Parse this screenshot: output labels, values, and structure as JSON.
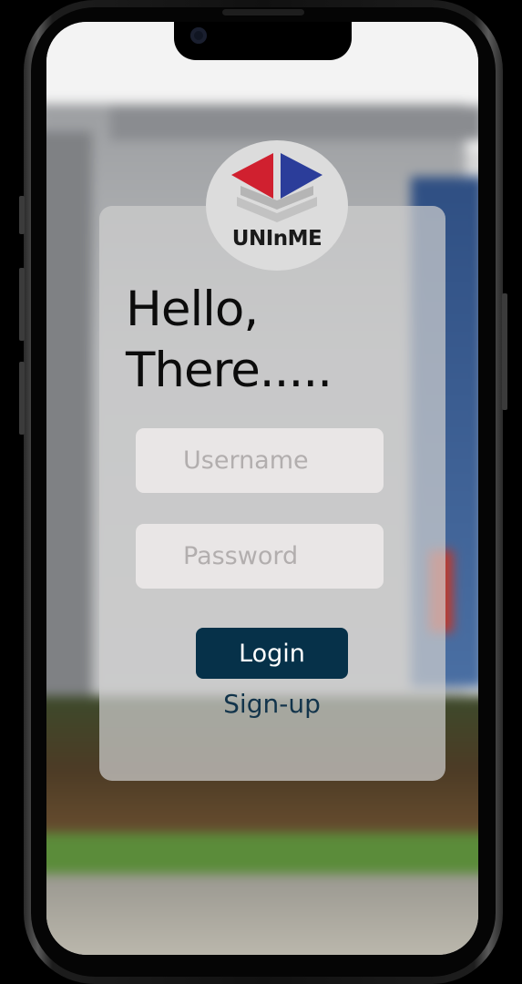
{
  "app": {
    "brand_name": "UNInME"
  },
  "greeting": {
    "line1": "Hello,",
    "line2": "There....."
  },
  "form": {
    "username_placeholder": "Username",
    "password_placeholder": "Password",
    "login_label": "Login",
    "signup_label": "Sign-up"
  },
  "colors": {
    "login_button": "#063149",
    "signup_text": "#12344b",
    "logo_red": "#d0202f",
    "logo_blue": "#2b3d9a",
    "logo_gray": "#b8b8b8"
  },
  "icons": {
    "logo": "uninme-logo-icon"
  }
}
